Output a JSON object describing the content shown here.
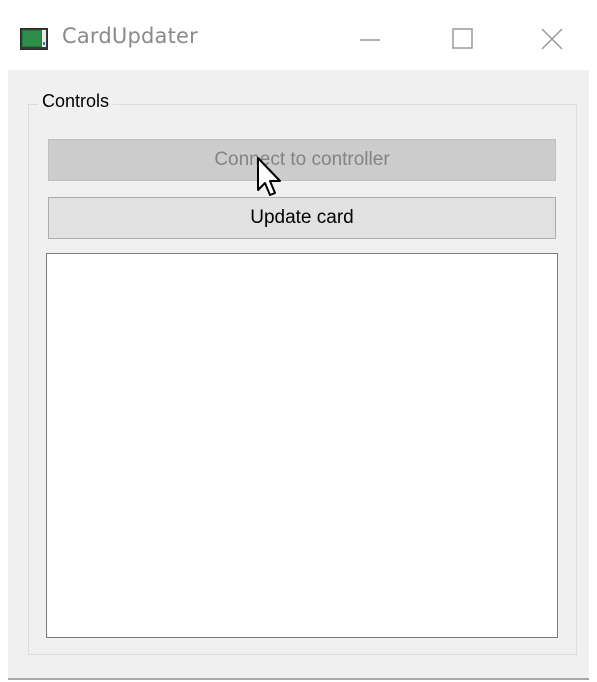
{
  "window": {
    "title": "CardUpdater",
    "app_icon": "app-window-icon",
    "controls": [
      "minimize-icon",
      "maximize-icon",
      "close-icon"
    ]
  },
  "controls_group": {
    "title": "Controls",
    "connect_button": {
      "label": "Connect to controller",
      "enabled": false
    },
    "update_button": {
      "label": "Update card",
      "enabled": true
    },
    "log_text": ""
  },
  "cursor": "arrow-cursor",
  "colors": {
    "client_bg": "#f0f0f0",
    "button_bg": "#e1e1e1",
    "disabled_button_bg": "#cccccc",
    "disabled_text": "#838383",
    "title_text": "#8a8a8a"
  }
}
